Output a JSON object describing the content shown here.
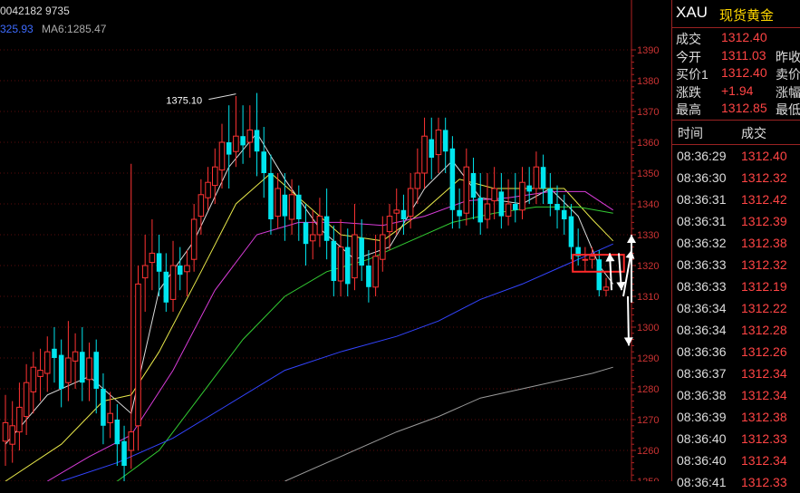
{
  "header": {
    "code_line": "0042182 9735"
  },
  "ma_line": {
    "ma_a": "325.93",
    "ma_b": "MA6:1285.47",
    "ma_a_color": "#3d6bff",
    "ma_b_color": "#aaaaaa"
  },
  "chart_data": {
    "type": "candlestick",
    "ylim": [
      1250,
      1393
    ],
    "yticks": [
      1390,
      1380,
      1370,
      1360,
      1350,
      1340,
      1330,
      1320,
      1310,
      1300,
      1290,
      1280,
      1270,
      1260,
      1250
    ],
    "annotation": {
      "text": "1375.10",
      "value": 1375.1
    },
    "candles": [
      [
        1263,
        1269,
        1255,
        1278
      ],
      [
        1262,
        1268,
        1256,
        1276
      ],
      [
        1266,
        1274,
        1260,
        1282
      ],
      [
        1271,
        1282,
        1265,
        1288
      ],
      [
        1279,
        1287,
        1272,
        1292
      ],
      [
        1284,
        1286,
        1276,
        1293
      ],
      [
        1285,
        1292,
        1279,
        1297
      ],
      [
        1293,
        1290,
        1282,
        1300
      ],
      [
        1291,
        1280,
        1274,
        1296
      ],
      [
        1282,
        1290,
        1276,
        1302
      ],
      [
        1289,
        1292,
        1280,
        1298
      ],
      [
        1292,
        1282,
        1276,
        1300
      ],
      [
        1283,
        1290,
        1276,
        1295
      ],
      [
        1292,
        1280,
        1272,
        1296
      ],
      [
        1280,
        1268,
        1262,
        1285
      ],
      [
        1269,
        1272,
        1264,
        1279
      ],
      [
        1270,
        1262,
        1255,
        1275
      ],
      [
        1263,
        1255,
        1250,
        1268
      ],
      [
        1260,
        1266,
        1254,
        1353
      ],
      [
        1268,
        1314,
        1260,
        1320
      ],
      [
        1316,
        1320,
        1305,
        1330
      ],
      [
        1321,
        1324,
        1312,
        1335
      ],
      [
        1324,
        1318,
        1310,
        1330
      ],
      [
        1318,
        1308,
        1305,
        1324
      ],
      [
        1309,
        1320,
        1305,
        1328
      ],
      [
        1320,
        1317,
        1312,
        1326
      ],
      [
        1318,
        1320,
        1310,
        1325
      ],
      [
        1322,
        1335,
        1318,
        1340
      ],
      [
        1336,
        1343,
        1330,
        1348
      ],
      [
        1342,
        1347,
        1338,
        1352
      ],
      [
        1346,
        1352,
        1340,
        1358
      ],
      [
        1351,
        1360,
        1345,
        1366
      ],
      [
        1360,
        1356,
        1345,
        1372
      ],
      [
        1357,
        1362,
        1352,
        1375
      ],
      [
        1362,
        1359,
        1353,
        1372
      ],
      [
        1360,
        1364,
        1355,
        1372
      ],
      [
        1364,
        1357,
        1349,
        1376
      ],
      [
        1357,
        1350,
        1342,
        1365
      ],
      [
        1350,
        1335,
        1330,
        1356
      ],
      [
        1336,
        1345,
        1332,
        1350
      ],
      [
        1343,
        1336,
        1328,
        1350
      ],
      [
        1335,
        1343,
        1330,
        1348
      ],
      [
        1343,
        1335,
        1328,
        1346
      ],
      [
        1334,
        1327,
        1320,
        1340
      ],
      [
        1328,
        1330,
        1322,
        1338
      ],
      [
        1330,
        1336,
        1326,
        1342
      ],
      [
        1336,
        1328,
        1322,
        1345
      ],
      [
        1328,
        1315,
        1310,
        1333
      ],
      [
        1315,
        1326,
        1310,
        1335
      ],
      [
        1326,
        1314,
        1310,
        1332
      ],
      [
        1316,
        1330,
        1312,
        1340
      ],
      [
        1329,
        1320,
        1315,
        1335
      ],
      [
        1320,
        1313,
        1308,
        1325
      ],
      [
        1313,
        1323,
        1310,
        1330
      ],
      [
        1322,
        1330,
        1318,
        1336
      ],
      [
        1331,
        1336,
        1325,
        1340
      ],
      [
        1337,
        1338,
        1330,
        1345
      ],
      [
        1338,
        1335,
        1330,
        1343
      ],
      [
        1336,
        1345,
        1332,
        1350
      ],
      [
        1345,
        1350,
        1340,
        1358
      ],
      [
        1350,
        1362,
        1345,
        1368
      ],
      [
        1361,
        1355,
        1348,
        1368
      ],
      [
        1356,
        1364,
        1350,
        1368
      ],
      [
        1364,
        1357,
        1350,
        1368
      ],
      [
        1358,
        1338,
        1332,
        1362
      ],
      [
        1338,
        1336,
        1332,
        1345
      ],
      [
        1337,
        1352,
        1333,
        1358
      ],
      [
        1350,
        1342,
        1335,
        1355
      ],
      [
        1342,
        1334,
        1330,
        1350
      ],
      [
        1335,
        1340,
        1332,
        1350
      ],
      [
        1341,
        1345,
        1335,
        1352
      ],
      [
        1344,
        1336,
        1332,
        1350
      ],
      [
        1336,
        1340,
        1333,
        1348
      ],
      [
        1340,
        1338,
        1334,
        1350
      ],
      [
        1338,
        1347,
        1335,
        1352
      ],
      [
        1346,
        1344,
        1340,
        1352
      ],
      [
        1345,
        1352,
        1340,
        1357
      ],
      [
        1352,
        1345,
        1340,
        1356
      ],
      [
        1345,
        1340,
        1336,
        1350
      ],
      [
        1340,
        1338,
        1332,
        1346
      ],
      [
        1338,
        1335,
        1330,
        1343
      ],
      [
        1336,
        1326,
        1322,
        1340
      ],
      [
        1326,
        1323,
        1320,
        1332
      ],
      [
        1322,
        1322,
        1318,
        1326
      ],
      [
        1322,
        1323,
        1319,
        1326
      ],
      [
        1322,
        1312,
        1310,
        1325
      ],
      [
        1312,
        1313,
        1310,
        1316
      ]
    ],
    "ma_lines": [
      {
        "color": "#dddddd",
        "points": [
          [
            0,
            1262
          ],
          [
            6,
            1278
          ],
          [
            12,
            1284
          ],
          [
            18,
            1272
          ],
          [
            22,
            1312
          ],
          [
            27,
            1328
          ],
          [
            32,
            1352
          ],
          [
            36,
            1363
          ],
          [
            40,
            1348
          ],
          [
            45,
            1332
          ],
          [
            50,
            1322
          ],
          [
            55,
            1326
          ],
          [
            60,
            1345
          ],
          [
            64,
            1354
          ],
          [
            68,
            1342
          ],
          [
            74,
            1340
          ],
          [
            78,
            1345
          ],
          [
            82,
            1336
          ],
          [
            85,
            1320
          ],
          [
            87,
            1314
          ]
        ]
      },
      {
        "color": "#e8e84a",
        "points": [
          [
            0,
            1250
          ],
          [
            8,
            1262
          ],
          [
            14,
            1276
          ],
          [
            18,
            1278
          ],
          [
            22,
            1292
          ],
          [
            28,
            1318
          ],
          [
            33,
            1340
          ],
          [
            38,
            1350
          ],
          [
            43,
            1340
          ],
          [
            48,
            1330
          ],
          [
            54,
            1328
          ],
          [
            60,
            1338
          ],
          [
            65,
            1348
          ],
          [
            70,
            1345
          ],
          [
            76,
            1345
          ],
          [
            80,
            1345
          ],
          [
            84,
            1335
          ],
          [
            87,
            1328
          ]
        ]
      },
      {
        "color": "#d83cd8",
        "points": [
          [
            6,
            1250
          ],
          [
            12,
            1258
          ],
          [
            18,
            1265
          ],
          [
            24,
            1286
          ],
          [
            30,
            1312
          ],
          [
            36,
            1330
          ],
          [
            42,
            1334
          ],
          [
            48,
            1334
          ],
          [
            54,
            1333
          ],
          [
            60,
            1336
          ],
          [
            66,
            1341
          ],
          [
            72,
            1342
          ],
          [
            78,
            1344
          ],
          [
            83,
            1344
          ],
          [
            87,
            1338
          ]
        ]
      },
      {
        "color": "#33cc33",
        "points": [
          [
            16,
            1250
          ],
          [
            22,
            1260
          ],
          [
            28,
            1278
          ],
          [
            34,
            1296
          ],
          [
            40,
            1310
          ],
          [
            46,
            1318
          ],
          [
            52,
            1322
          ],
          [
            58,
            1328
          ],
          [
            64,
            1334
          ],
          [
            70,
            1337
          ],
          [
            76,
            1339
          ],
          [
            82,
            1339
          ],
          [
            87,
            1337
          ]
        ]
      },
      {
        "color": "#3344ff",
        "points": [
          [
            8,
            1250
          ],
          [
            16,
            1256
          ],
          [
            24,
            1264
          ],
          [
            32,
            1275
          ],
          [
            40,
            1286
          ],
          [
            48,
            1292
          ],
          [
            56,
            1297
          ],
          [
            62,
            1302
          ],
          [
            68,
            1309
          ],
          [
            74,
            1314
          ],
          [
            80,
            1320
          ],
          [
            84,
            1324
          ],
          [
            87,
            1327
          ]
        ]
      },
      {
        "color": "#9a9a9a",
        "points": [
          [
            40,
            1250
          ],
          [
            48,
            1258
          ],
          [
            56,
            1266
          ],
          [
            62,
            1271
          ],
          [
            68,
            1277
          ],
          [
            74,
            1280
          ],
          [
            80,
            1283
          ],
          [
            84,
            1285
          ],
          [
            87,
            1287
          ]
        ]
      }
    ]
  },
  "panel": {
    "symbol": "XAU",
    "name": "现货黄金",
    "quote": [
      {
        "k": "成交",
        "v": "1312.40",
        "k2": ""
      },
      {
        "k": "今开",
        "v": "1311.03",
        "k2": "昨收"
      },
      {
        "k": "买价1",
        "v": "1312.40",
        "k2": "卖价"
      },
      {
        "k": "涨跌",
        "v": "+1.94",
        "k2": "涨幅"
      },
      {
        "k": "最高",
        "v": "1312.85",
        "k2": "最低"
      }
    ],
    "trades_header": {
      "time": "时间",
      "price": "成交"
    },
    "trades": [
      {
        "t": "08:36:29",
        "p": "1312.40"
      },
      {
        "t": "08:36:30",
        "p": "1312.32"
      },
      {
        "t": "08:36:31",
        "p": "1312.42"
      },
      {
        "t": "08:36:31",
        "p": "1312.39"
      },
      {
        "t": "08:36:32",
        "p": "1312.38"
      },
      {
        "t": "08:36:33",
        "p": "1312.32"
      },
      {
        "t": "08:36:33",
        "p": "1312.19"
      },
      {
        "t": "08:36:34",
        "p": "1312.22"
      },
      {
        "t": "08:36:34",
        "p": "1312.28"
      },
      {
        "t": "08:36:36",
        "p": "1312.26"
      },
      {
        "t": "08:36:37",
        "p": "1312.34"
      },
      {
        "t": "08:36:38",
        "p": "1312.34"
      },
      {
        "t": "08:36:39",
        "p": "1312.38"
      },
      {
        "t": "08:36:40",
        "p": "1312.33"
      },
      {
        "t": "08:36:40",
        "p": "1312.34"
      },
      {
        "t": "08:36:41",
        "p": "1312.33"
      }
    ]
  },
  "colors": {
    "up": "#ff3333",
    "down": "#00e5ee",
    "grid": "#5a0d0d",
    "axis": "#b02222",
    "tick_text": "#cc3333"
  }
}
